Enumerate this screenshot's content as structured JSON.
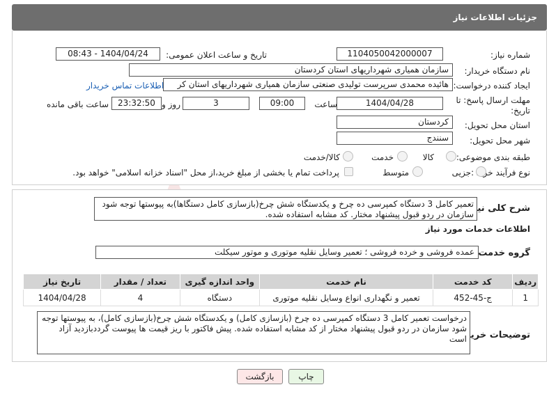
{
  "header": {
    "title": "جزئیات اطلاعات نیاز"
  },
  "form": {
    "need_number_label": "شماره نیاز:",
    "need_number_value": "1104050042000007",
    "announce_datetime_label": "تاریخ و ساعت اعلان عمومی:",
    "announce_datetime_value": "1404/04/24 - 08:43",
    "buyer_org_label": "نام دستگاه خریدار:",
    "buyer_org_value": "سازمان همیاری شهرداریهای استان کردستان",
    "requester_label": "ایجاد کننده درخواست:",
    "requester_value": "هائیده محمدی سرپرست تولیدی صنعتی سازمان همیاری شهرداریهای استان کر",
    "contact_link": "اطلاعات تماس خریدار",
    "deadline_label_1": "مهلت ارسال پاسخ: تا",
    "deadline_label_2": "تاریخ:",
    "deadline_date": "1404/04/28",
    "time_label": "ساعت",
    "deadline_time": "09:00",
    "days_value": "3",
    "days_label": "روز و",
    "remaining_time": "23:32:50",
    "remaining_label": "ساعت باقی مانده",
    "province_label": "استان محل تحویل:",
    "province_value": "کردستان",
    "city_label": "شهر محل تحویل:",
    "city_value": "سنندج",
    "category_label": "طبقه بندی موضوعی:",
    "category_options": [
      "کالا",
      "خدمت",
      "کالا/خدمت"
    ],
    "process_label": "نوع فرآیند خرید :",
    "process_options": [
      "جزیی",
      "متوسط"
    ],
    "payment_note": "پرداخت تمام یا بخشی از مبلغ خرید،از محل \"اسناد خزانه اسلامی\" خواهد بود."
  },
  "summary": {
    "label": "شرح کلی نیاز:",
    "text": "تعمیر کامل 3 دستگاه کمپرسی ده چرخ و یکدستگاه شش چرخ(بازسازی کامل دستگاها)به پیوستها توجه شود سازمان در ردو قبول پیشنهاد مختار. کد مشابه استفاده شده."
  },
  "services": {
    "section_title": "اطلاعات خدمات مورد نیاز",
    "group_label": "گروه خدمت:",
    "group_value": "عمده فروشی و خرده فروشی ؛ تعمیر وسایل نقلیه موتوری و موتور سیکلت",
    "columns": [
      "ردیف",
      "کد خدمت",
      "نام خدمت",
      "واحد اندازه گیری",
      "تعداد / مقدار",
      "تاریخ نیاز"
    ],
    "rows": [
      [
        "1",
        "ج-45-452",
        "تعمیر و نگهداری انواع وسایل نقلیه موتوری",
        "دستگاه",
        "4",
        "1404/04/28"
      ]
    ]
  },
  "buyer_notes": {
    "label": "توضیحات خریدار:",
    "text": "درخواست تعمیر کامل 3 دستگاه کمپرسی ده چرخ (بازسازی کامل) و یکدستگاه شش چرخ(بازسازی کامل)، به پیوستها توجه شود سازمان در ردو قبول پیشنهاد مختار از کد مشابه استفاده شده. پیش فاکتور با ریز قیمت ها پیوست گرددبازدید آزاد است"
  },
  "buttons": {
    "print": "چاپ",
    "back": "بازگشت"
  },
  "colors": {
    "header_bg": "#6e6e6e",
    "back_button_bg": "#fde7e7",
    "print_button_bg": "#e8f7e4",
    "link": "#1a5fb4"
  }
}
